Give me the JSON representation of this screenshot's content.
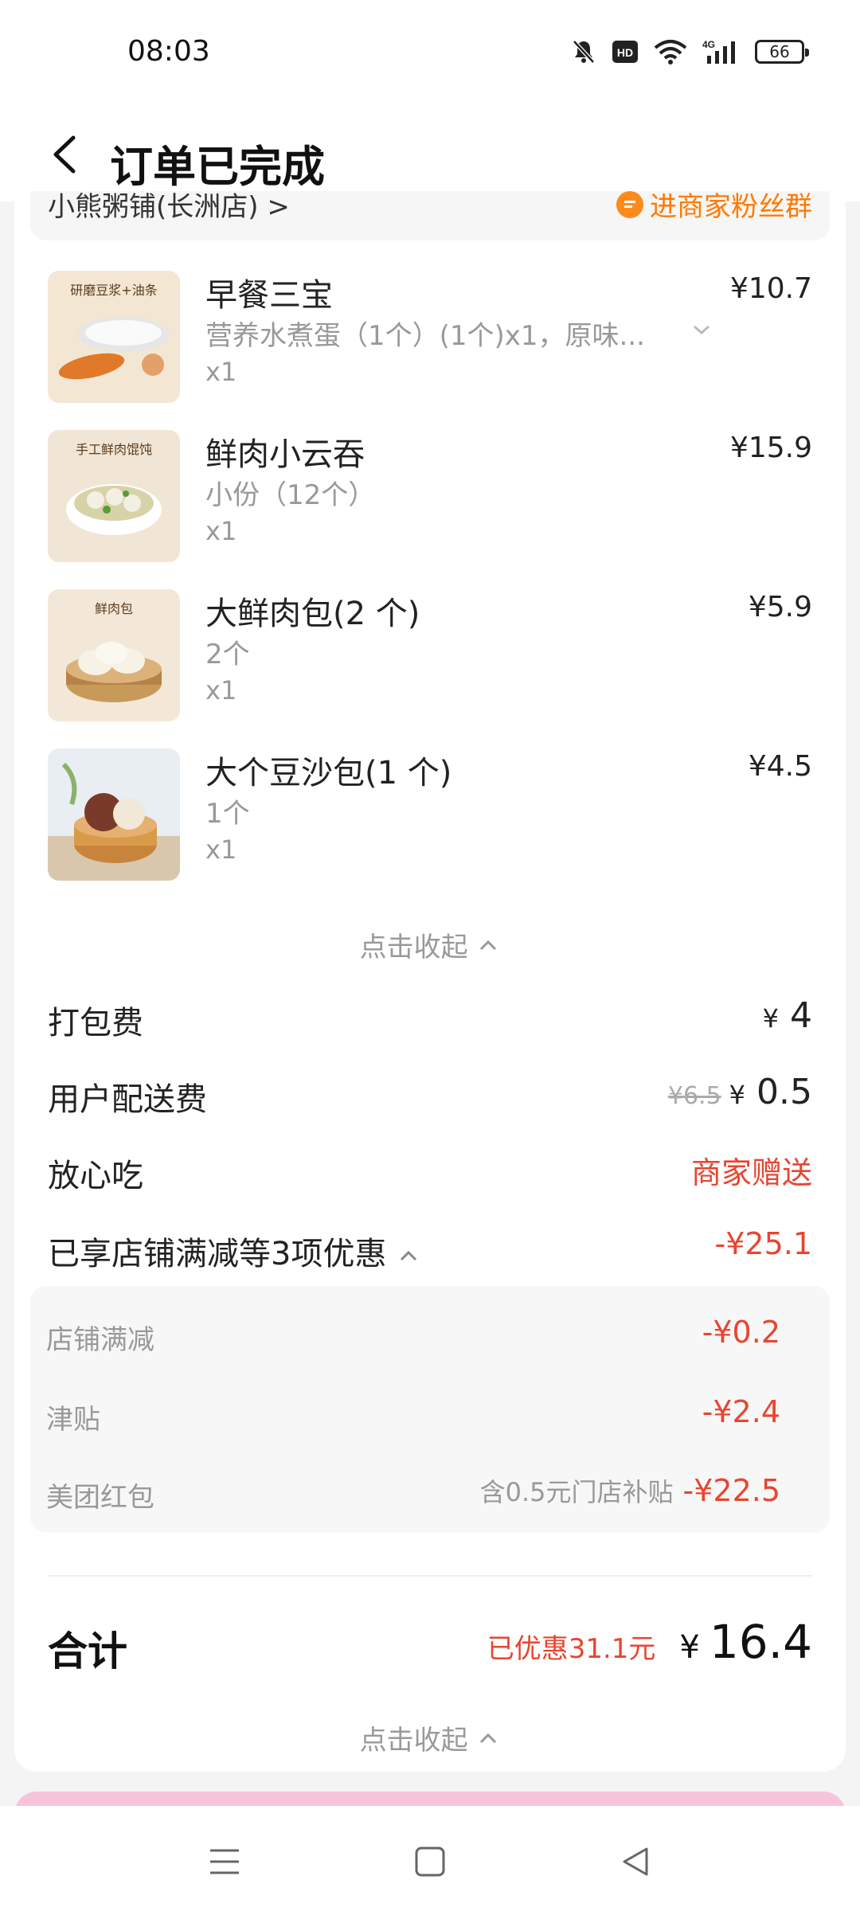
{
  "status_bar": {
    "time": "08:03",
    "battery": "66",
    "network": "4G"
  },
  "header": {
    "title": "订单已完成"
  },
  "shop": {
    "name": "小熊粥铺(长洲店)",
    "arrow": ">",
    "fans_link": "进商家粉丝群"
  },
  "items": [
    {
      "name": "早餐三宝",
      "spec": "营养水煮蛋（1个）(1个)x1，原味...",
      "qty": "x1",
      "price": "¥10.7",
      "thumb_text": "研磨豆浆+油条"
    },
    {
      "name": "鲜肉小云吞",
      "spec": "小份（12个）",
      "qty": "x1",
      "price": "¥15.9",
      "thumb_text": "手工鲜肉馄饨"
    },
    {
      "name": "大鲜肉包(2 个)",
      "spec": "2个",
      "qty": "x1",
      "price": "¥5.9",
      "thumb_text": "鲜肉包"
    },
    {
      "name": "大个豆沙包(1 个)",
      "spec": "1个",
      "qty": "x1",
      "price": "¥4.5",
      "thumb_text": ""
    }
  ],
  "collapse_label": "点击收起",
  "fees": {
    "packing": {
      "label": "打包费",
      "yen": "¥",
      "value": "4"
    },
    "delivery": {
      "label": "用户配送费",
      "original": "¥6.5",
      "yen": "¥",
      "value": "0.5"
    },
    "safe": {
      "label": "放心吃",
      "value": "商家赠送"
    },
    "discount": {
      "label": "已享店铺满减等3项优惠",
      "value": "-¥25.1"
    }
  },
  "discounts": [
    {
      "label": "店铺满减",
      "note": "",
      "value": "-¥0.2"
    },
    {
      "label": "津贴",
      "note": "",
      "value": "-¥2.4"
    },
    {
      "label": "美团红包",
      "note": "含0.5元门店补贴",
      "value": "-¥22.5"
    }
  ],
  "total": {
    "label": "合计",
    "saved": "已优惠31.1元",
    "yen": "¥",
    "amount": "16.4"
  },
  "colors": {
    "accent_red": "#e8452f",
    "accent_orange": "#ff7a00"
  }
}
